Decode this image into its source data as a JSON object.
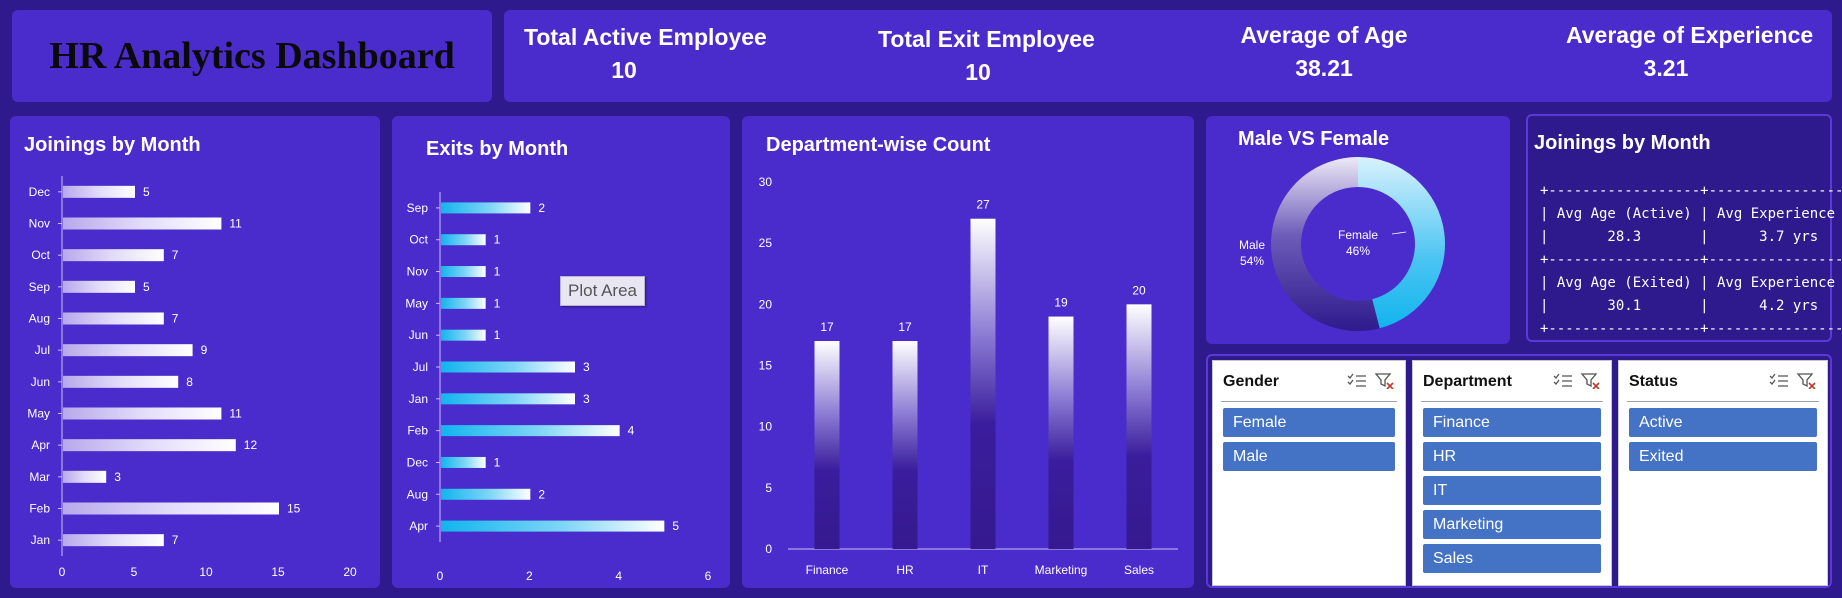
{
  "header": {
    "title": "HR Analytics Dashboard"
  },
  "kpis": [
    {
      "label": "Total Active Employee",
      "value": "10"
    },
    {
      "label": "Total Exit Employee",
      "value": "10"
    },
    {
      "label": "Average of Age",
      "value": "38.21"
    },
    {
      "label": "Average of Experience",
      "value": "3.21"
    }
  ],
  "tooltip": "Plot Area",
  "info_box": {
    "title": "Joinings by Month",
    "lines": [
      "+------------------+-------------------+",
      "| Avg Age (Active) | Avg Experience    |",
      "|       28.3       |      3.7 yrs      |",
      "+------------------+-------------------+",
      "| Avg Age (Exited) | Avg Experience    |",
      "|       30.1       |      4.2 yrs      |",
      "+------------------+-------------------+"
    ]
  },
  "slicers": [
    {
      "title": "Gender",
      "items": [
        "Female",
        "Male"
      ]
    },
    {
      "title": "Department",
      "items": [
        "Finance",
        "HR",
        "IT",
        "Marketing",
        "Sales"
      ]
    },
    {
      "title": "Status",
      "items": [
        "Active",
        "Exited"
      ]
    }
  ],
  "colors": {
    "background": "#2e1a8c",
    "panel": "#4a2bcc",
    "slicer_item": "#4472c4",
    "cyan": "#12b4ee"
  },
  "chart_data": [
    {
      "type": "bar",
      "orientation": "horizontal",
      "title": "Joinings by Month",
      "categories": [
        "Dec",
        "Nov",
        "Oct",
        "Sep",
        "Aug",
        "Jul",
        "Jun",
        "May",
        "Apr",
        "Mar",
        "Feb",
        "Jan"
      ],
      "values": [
        5,
        11,
        7,
        5,
        7,
        9,
        8,
        11,
        12,
        3,
        15,
        7
      ],
      "xlim": [
        0,
        20
      ],
      "xticks": [
        0,
        5,
        10,
        15,
        20
      ]
    },
    {
      "type": "bar",
      "orientation": "horizontal",
      "title": "Exits by Month",
      "categories": [
        "Sep",
        "Oct",
        "Nov",
        "May",
        "Jun",
        "Jul",
        "Jan",
        "Feb",
        "Dec",
        "Aug",
        "Apr"
      ],
      "values": [
        2,
        1,
        1,
        1,
        1,
        3,
        3,
        4,
        1,
        2,
        5
      ],
      "xlim": [
        0,
        6
      ],
      "xticks": [
        0,
        2,
        4,
        6
      ]
    },
    {
      "type": "bar",
      "title": "Department-wise Count",
      "categories": [
        "Finance",
        "HR",
        "IT",
        "Marketing",
        "Sales"
      ],
      "values": [
        17,
        17,
        27,
        19,
        20
      ],
      "ylim": [
        0,
        30
      ],
      "yticks": [
        0,
        5,
        10,
        15,
        20,
        25,
        30
      ]
    },
    {
      "type": "pie",
      "donut": true,
      "title": "Male VS Female",
      "categories": [
        "Female",
        "Male"
      ],
      "values": [
        46,
        54
      ],
      "labels": [
        "46%",
        "54%"
      ]
    }
  ]
}
